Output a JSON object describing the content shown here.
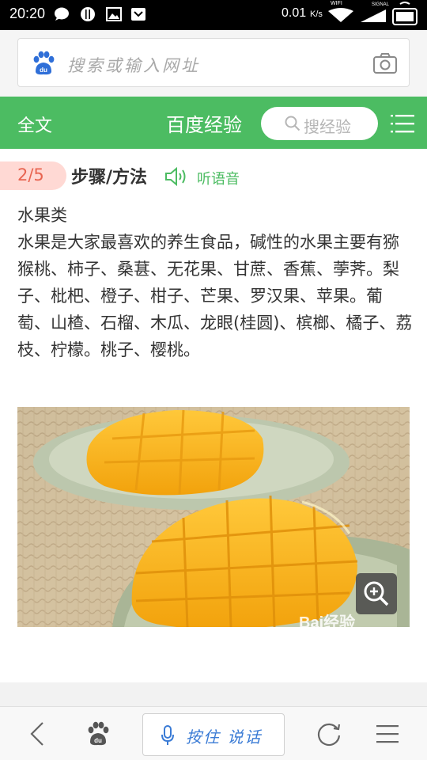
{
  "status_bar": {
    "time": "20:20",
    "speed": "0.01",
    "speed_unit": "K/s",
    "wifi_label": "WIFI",
    "signal_label": "SIGNAL"
  },
  "browser": {
    "search_placeholder": "搜索或输入网址"
  },
  "nav": {
    "fulltext_label": "全文",
    "brand": "百度经验",
    "search_label": "搜经验"
  },
  "step": {
    "counter": "2/5",
    "title": "步骤/方法",
    "listen_label": "听语音"
  },
  "content": {
    "heading": "水果类",
    "body": "水果是大家最喜欢的养生食品，碱性的水果主要有猕猴桃、柿子、桑葚、无花果、甘蔗、香蕉、荸荠。梨子、枇杷、橙子、柑子、芒果、罗汉果、苹果。葡萄、山楂、石榴、木瓜、龙眼(桂圆)、槟榔、橘子、荔枝、柠檬。桃子、樱桃。"
  },
  "image": {
    "watermark": "Bai经验"
  },
  "bottom_bar": {
    "voice_label": "按住 说话"
  },
  "colors": {
    "accent_green": "#4cbc62",
    "step_badge_bg": "#ffd9d4",
    "step_badge_text": "#e86450",
    "voice_blue": "#3a7bd5"
  }
}
